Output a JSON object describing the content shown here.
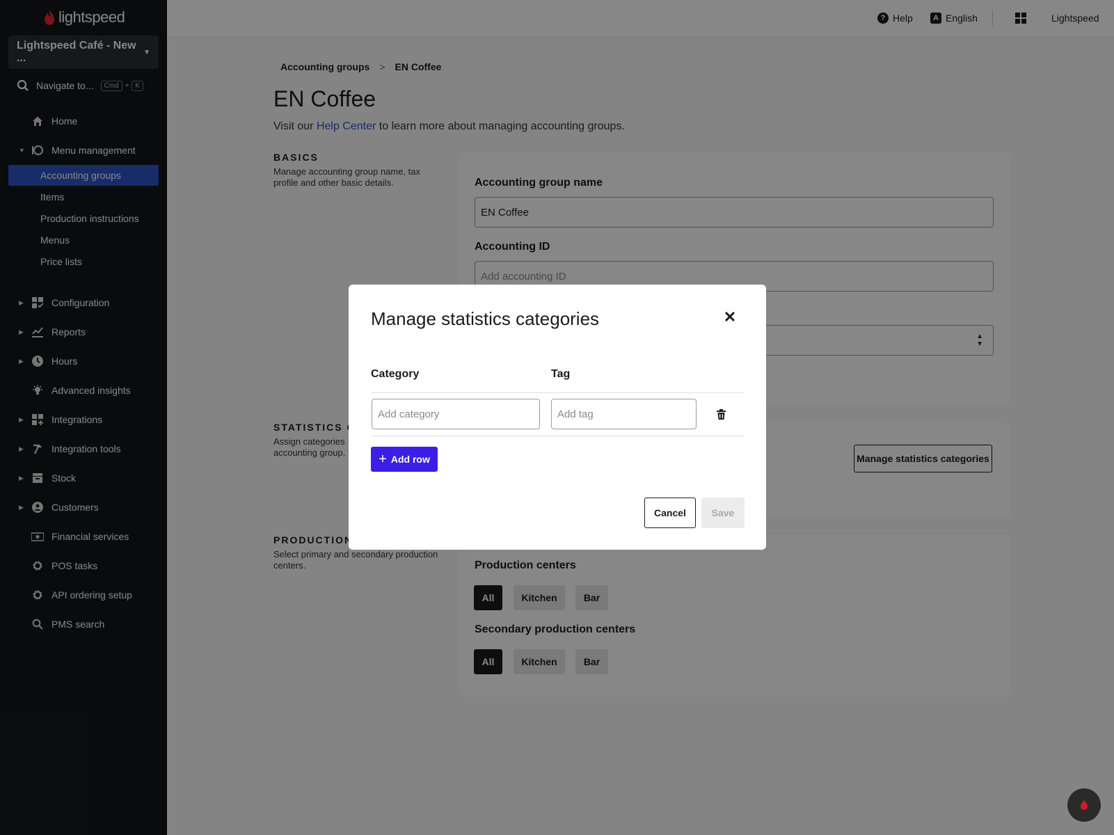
{
  "colors": {
    "accent": "#2f53c8",
    "primary_button": "#3b1fe6",
    "sidebar_bg": "#141618",
    "logo_red": "#e8262f"
  },
  "sidebar": {
    "logo_text": "lightspeed",
    "venue": "Lightspeed Café - New ...",
    "search_label": "Navigate to...",
    "shortcut_key1": "Cmd",
    "shortcut_plus": "+",
    "shortcut_key2": "K",
    "items": [
      {
        "label": "Home",
        "icon": "home-icon"
      },
      {
        "label": "Menu management",
        "icon": "menu-management-icon",
        "expanded": true
      },
      {
        "label": "Configuration",
        "icon": "configuration-icon"
      },
      {
        "label": "Reports",
        "icon": "reports-icon"
      },
      {
        "label": "Hours",
        "icon": "clock-icon"
      },
      {
        "label": "Advanced insights",
        "icon": "lightbulb-icon"
      },
      {
        "label": "Integrations",
        "icon": "integrations-icon"
      },
      {
        "label": "Integration tools",
        "icon": "hammer-icon"
      },
      {
        "label": "Stock",
        "icon": "stock-icon"
      },
      {
        "label": "Customers",
        "icon": "customer-icon"
      },
      {
        "label": "Financial services",
        "icon": "cash-icon"
      },
      {
        "label": "POS tasks",
        "icon": "gear-icon"
      },
      {
        "label": "API ordering setup",
        "icon": "gear-icon"
      },
      {
        "label": "PMS search",
        "icon": "search-icon"
      }
    ],
    "sub_items": [
      {
        "label": "Accounting groups",
        "active": true
      },
      {
        "label": "Items"
      },
      {
        "label": "Production instructions"
      },
      {
        "label": "Menus"
      },
      {
        "label": "Price lists"
      }
    ]
  },
  "topbar": {
    "help": "Help",
    "language": "English",
    "account": "Lightspeed"
  },
  "main": {
    "breadcrumb": [
      "Accounting groups",
      "EN Coffee"
    ],
    "breadcrumb_sep": ">",
    "title": "EN Coffee",
    "desc_before": "Visit our ",
    "desc_link": "Help Center",
    "desc_after": " to learn more about managing accounting groups.",
    "basics": {
      "heading": "BASICS",
      "desc": "Manage accounting group name, tax profile and other basic details.",
      "name_label": "Accounting group name",
      "name_value": "EN Coffee",
      "id_label": "Accounting ID",
      "id_placeholder": "Add accounting ID"
    },
    "statistics": {
      "heading": "STATISTICS CA",
      "desc": "Assign categories accounting group.",
      "manage_button": "Manage statistics categories"
    },
    "production": {
      "heading": "PRODUCTION",
      "desc": "Select primary and secondary production centers.",
      "centers_label": "Production centers",
      "secondary_label": "Secondary production centers",
      "chips": [
        "All",
        "Kitchen",
        "Bar"
      ],
      "selected": "All"
    }
  },
  "modal": {
    "title": "Manage statistics categories",
    "col_category": "Category",
    "col_tag": "Tag",
    "category_placeholder": "Add category",
    "tag_placeholder": "Add tag",
    "add_row": "Add row",
    "cancel": "Cancel",
    "save": "Save"
  }
}
